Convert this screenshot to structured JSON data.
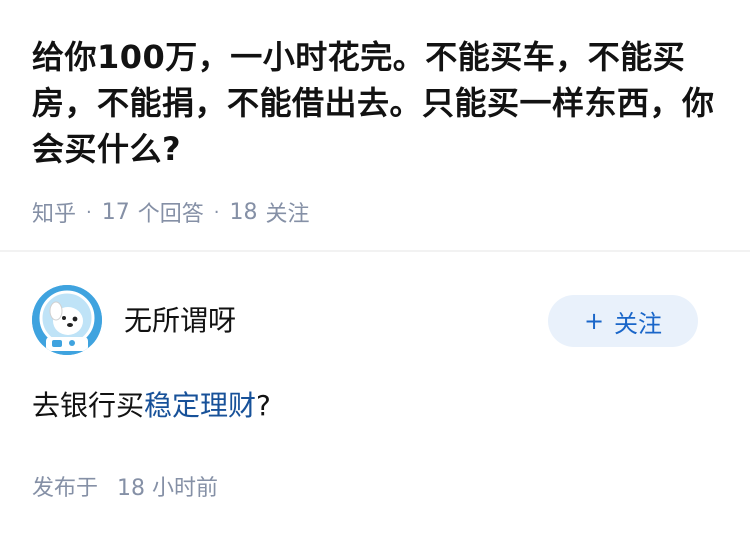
{
  "question": {
    "title": "给你100万，一小时花完。不能买车，不能买房，不能捐，不能借出去。只能买一样东西，你会买什么?",
    "source": "知乎",
    "answer_count": "17",
    "answer_label": "个回答",
    "follow_count": "18",
    "follow_label": "关注"
  },
  "answer": {
    "author_name": "无所谓呀",
    "follow_button": {
      "plus": "+",
      "label": "关注"
    },
    "content_prefix": "去银行买",
    "content_link": "稳定理财",
    "content_suffix": "?",
    "published_label": "发布于",
    "published_time": "18 小时前"
  },
  "colors": {
    "link": "#175199",
    "meta": "#8590a6",
    "button_bg": "#e9f1fb",
    "avatar_bg": "#3fa3df"
  },
  "icons": {
    "avatar": "astronaut-dog-avatar"
  }
}
